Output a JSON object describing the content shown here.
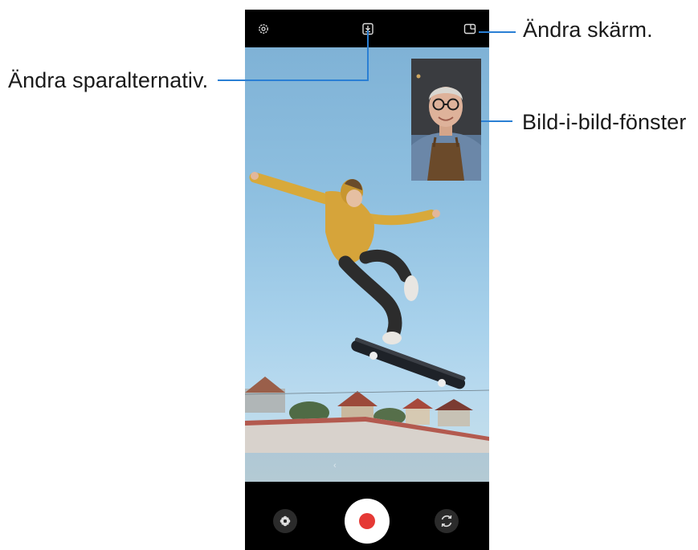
{
  "callouts": {
    "change_screen": "Ändra skärm.",
    "save_options": "Ändra sparalternativ.",
    "pip_window": "Bild-i-bild-fönster"
  },
  "topbar": {
    "settings_icon": "gear-icon",
    "save_icon": "download-icon",
    "layout_icon": "screen-layout-icon"
  },
  "viewfinder": {
    "zoom_hint": "‹"
  },
  "bottombar": {
    "effects_icon": "flower-icon",
    "record_icon": "record-icon",
    "switch_icon": "switch-camera-icon"
  },
  "colors": {
    "record": "#e53935",
    "callout_line": "#2a7fd4"
  }
}
